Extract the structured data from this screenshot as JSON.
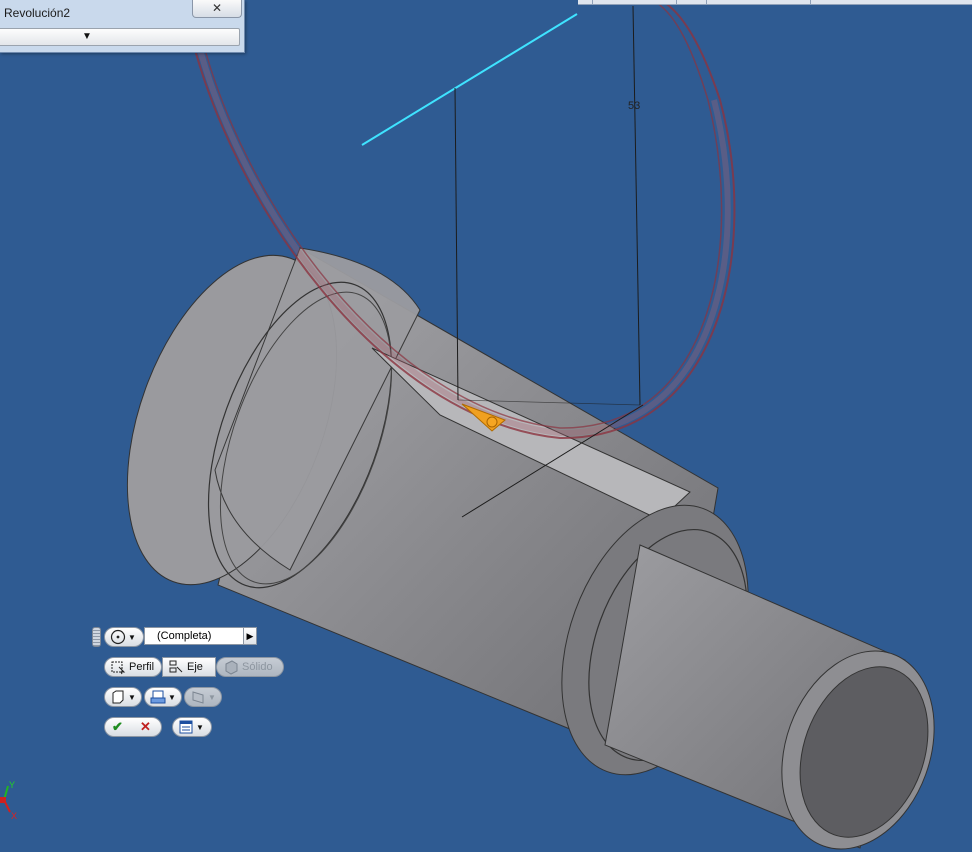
{
  "dialog": {
    "title": "Revolución2",
    "close_glyph": "✕",
    "expand_glyph": "▼"
  },
  "viewport": {
    "background": "#2f5b92",
    "dimension_label": "53",
    "axis_labels": {
      "y": "Y",
      "x": "X"
    }
  },
  "mini_toolbar": {
    "extent_value": "(Completa)",
    "profile_label": "Perfil",
    "axis_label": "Eje",
    "solid_label": "Sólido",
    "ok_glyph": "✔",
    "cancel_glyph": "✕",
    "dropdown_glyph": "▼",
    "combo_arrow_glyph": "▶"
  },
  "icons": [
    "revolve-extent-icon",
    "profile-select-icon",
    "axis-select-icon",
    "solid-icon",
    "output-solid-icon",
    "operation-join-icon",
    "taper-icon",
    "ok-icon",
    "cancel-icon",
    "options-icon"
  ],
  "colors": {
    "shaft": "#8b8b8f",
    "ring": "#8c3340",
    "sketch_line": "#3fe3ff",
    "ok": "#1f8c1f",
    "cancel": "#c02020"
  }
}
